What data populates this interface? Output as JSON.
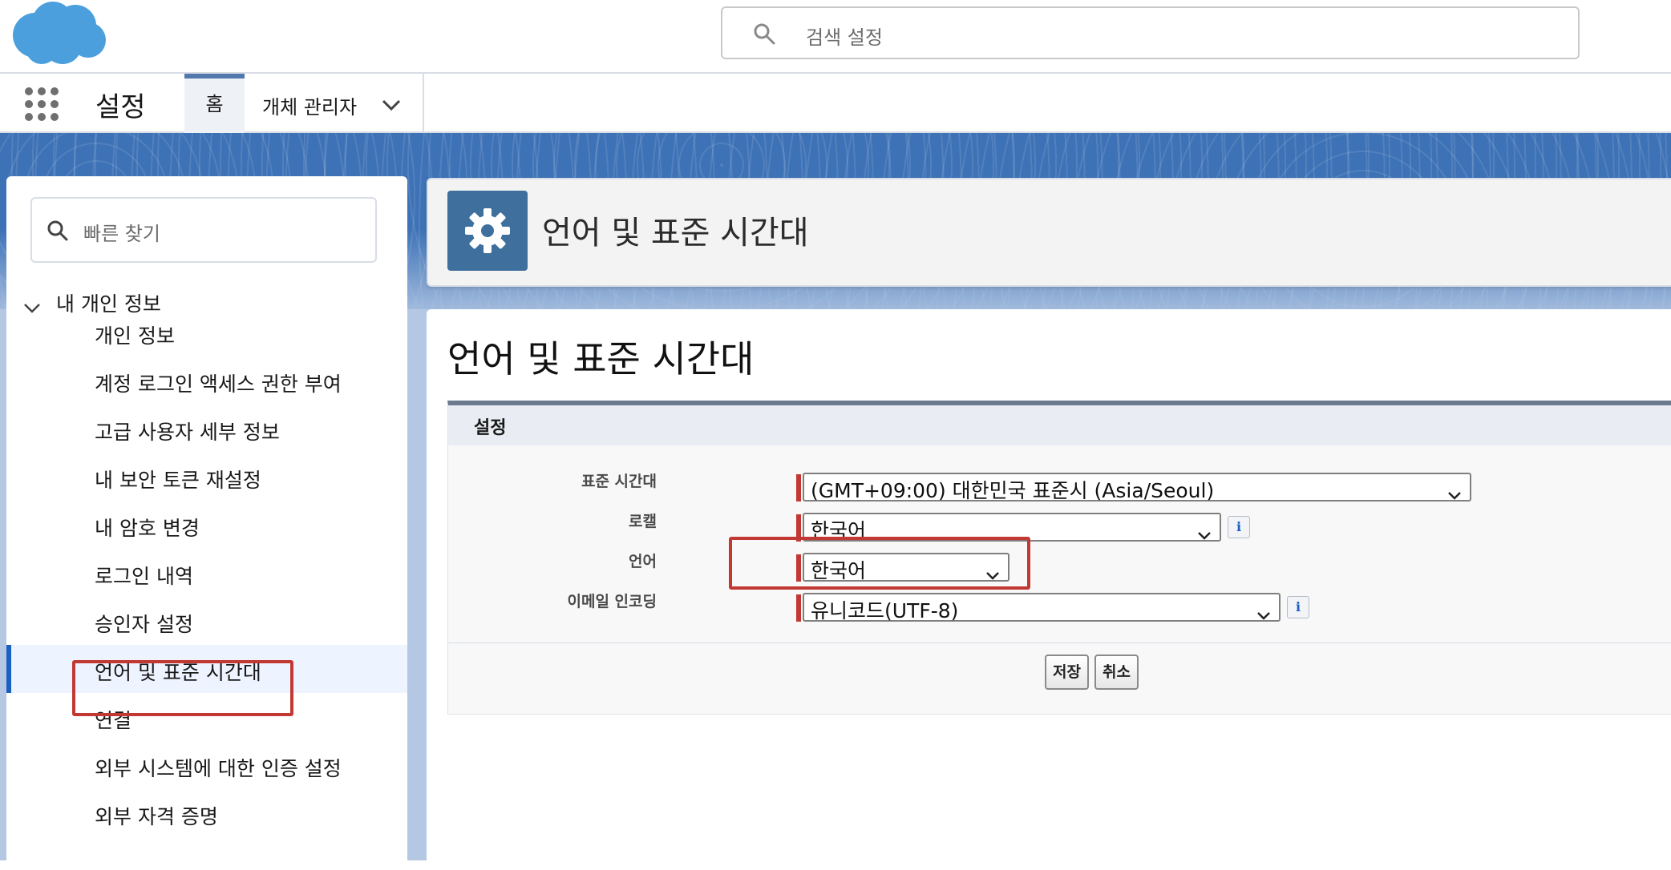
{
  "header": {
    "search_placeholder": "검색 설정"
  },
  "nav": {
    "app_name": "설정",
    "tabs": [
      {
        "label": "홈"
      },
      {
        "label": "개체 관리자"
      }
    ]
  },
  "sidebar": {
    "quickfind_placeholder": "빠른 찾기",
    "section_label": "내 개인 정보",
    "items": [
      {
        "label": "개인 정보"
      },
      {
        "label": "계정 로그인 액세스 권한 부여"
      },
      {
        "label": "고급 사용자 세부 정보"
      },
      {
        "label": "내 보안 토큰 재설정"
      },
      {
        "label": "내 암호 변경"
      },
      {
        "label": "로그인 내역"
      },
      {
        "label": "승인자 설정"
      },
      {
        "label": "언어 및 표준 시간대"
      },
      {
        "label": "연결"
      },
      {
        "label": "외부 시스템에 대한 인증 설정"
      },
      {
        "label": "외부 자격 증명"
      }
    ],
    "active_item": "언어 및 표준 시간대"
  },
  "page_header": {
    "title": "언어 및 표준 시간대"
  },
  "main": {
    "title": "언어 및 표준 시간대",
    "section_title": "설정",
    "fields": {
      "timezone": {
        "label": "표준 시간대",
        "value": "(GMT+09:00) 대한민국 표준시 (Asia/Seoul)"
      },
      "locale": {
        "label": "로캘",
        "value": "한국어"
      },
      "language": {
        "label": "언어",
        "value": "한국어"
      },
      "email_encoding": {
        "label": "이메일 인코딩",
        "value": "유니코드(UTF-8)"
      }
    },
    "info_glyph": "i",
    "buttons": {
      "save": "저장",
      "cancel": "취소"
    }
  },
  "colors": {
    "brand_cloud": "#4a9fdc",
    "header_band": "#3d72b6",
    "required": "#c23934",
    "active_nav": "#1b5fc1"
  }
}
